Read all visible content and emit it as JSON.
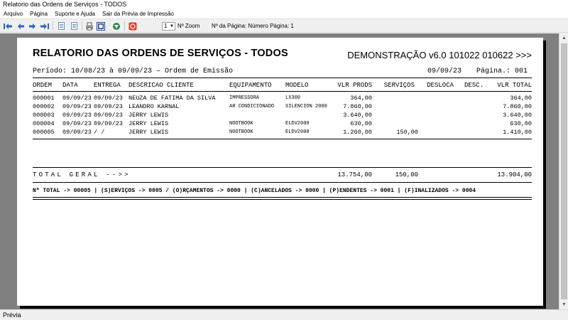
{
  "window": {
    "title": "Relatorio das Ordens de Serviços - TODOS"
  },
  "menu": [
    "Arquivo",
    "Página",
    "Suporte e Ajuda",
    "Sair da Prévia de Impressão"
  ],
  "toolbar": {
    "icons": [
      "first-page-icon",
      "previous-page-icon",
      "next-page-icon",
      "last-page-icon",
      "page-layout-icon",
      "page-setup-icon",
      "print-icon",
      "pdf-export-icon",
      "excel-export-icon",
      "close-icon"
    ],
    "zoom_value": "1",
    "zoom_label": "Nº Zoom",
    "page_label": "Nº da Página: Número Página: 1"
  },
  "report": {
    "title": "RELATORIO DAS ORDENS DE SERVIÇOS - TODOS",
    "demo": "DEMONSTRAÇÃO v6.0 101022 010622 >>>",
    "period": "Período: 10/08/23 à 09/09/23 – Ordem de Emissão",
    "date": "09/09/23",
    "page": "Página.: 001",
    "columns": {
      "ordem": "ORDEM",
      "data": "DATA",
      "entrega": "ENTREGA",
      "cliente": "DESCRICAO CLIENTE",
      "equipamento": "EQUIPAMENTO",
      "modelo": "MODELO",
      "prods": "VLR PRODS",
      "servicos": "SERVIÇOS",
      "desloca": "DESLOCA",
      "desc": "DESC.",
      "total": "VLR TOTAL"
    },
    "rows": [
      {
        "ordem": "000001",
        "data": "09/09/23",
        "entrega": "09/09/23",
        "cliente": "NEUZA DE FATIMA DA SILVA",
        "equipamento": "IMPRESSORA",
        "modelo": "LX300",
        "prods": "364,00",
        "servicos": "",
        "desloca": "",
        "desc": "",
        "total": "364,00"
      },
      {
        "ordem": "000002",
        "data": "09/09/23",
        "entrega": "09/09/23",
        "cliente": "LEANDRO KARNAL",
        "equipamento": "AR CONDICIONADO",
        "modelo": "SILENCION 2000",
        "prods": "7.860,00",
        "servicos": "",
        "desloca": "",
        "desc": "",
        "total": "7.860,00"
      },
      {
        "ordem": "000003",
        "data": "09/09/23",
        "entrega": "09/09/23",
        "cliente": "JERRY LEWIS",
        "equipamento": "",
        "modelo": "",
        "prods": "3.640,00",
        "servicos": "",
        "desloca": "",
        "desc": "",
        "total": "3.640,00"
      },
      {
        "ordem": "000004",
        "data": "09/09/23",
        "entrega": "09/09/23",
        "cliente": "JERRY LEWIS",
        "equipamento": "NOOTBOOK",
        "modelo": "ELDV2000",
        "prods": "630,00",
        "servicos": "",
        "desloca": "",
        "desc": "",
        "total": "630,00"
      },
      {
        "ordem": "000005",
        "data": "09/09/23",
        "entrega": "/   /",
        "cliente": "JERRY LEWIS",
        "equipamento": "NOOTBOOK",
        "modelo": "ELDV2000",
        "prods": "1.260,00",
        "servicos": "150,00",
        "desloca": "",
        "desc": "",
        "total": "1.410,00"
      }
    ],
    "total_geral": {
      "label": "TOTAL GERAL -->>",
      "prods": "13.754,00",
      "servicos": "150,00",
      "total": "13.904,00"
    },
    "summary": "Nº TOTAL -> 00005 | (S)ERVIÇOS -> 0005 / (O)RÇAMENTOS -> 0000 | (C)ANCELADOS -> 0000 | (P)ENDENTES -> 0001 | (F)INALIZADOS -> 0004"
  },
  "status": {
    "text": "Prévia"
  }
}
